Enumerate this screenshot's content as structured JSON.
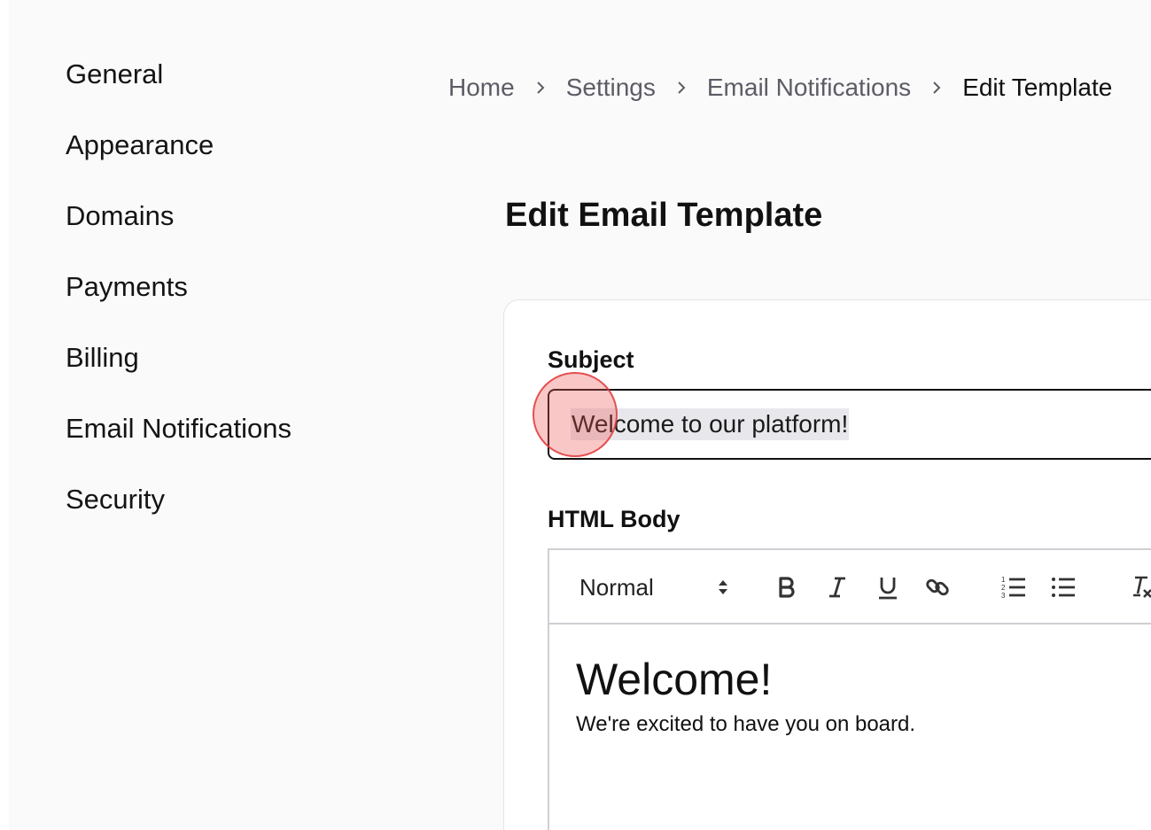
{
  "sidebar": {
    "items": [
      {
        "label": "General"
      },
      {
        "label": "Appearance"
      },
      {
        "label": "Domains"
      },
      {
        "label": "Payments"
      },
      {
        "label": "Billing"
      },
      {
        "label": "Email Notifications"
      },
      {
        "label": "Security"
      }
    ]
  },
  "breadcrumb": {
    "items": [
      {
        "label": "Home"
      },
      {
        "label": "Settings"
      },
      {
        "label": "Email Notifications"
      },
      {
        "label": "Edit Template"
      }
    ]
  },
  "page": {
    "title": "Edit Email Template"
  },
  "form": {
    "subject_label": "Subject",
    "subject_value": "Welcome to our platform!",
    "body_label": "HTML Body"
  },
  "editor": {
    "format_value": "Normal",
    "toolbar_icons": [
      "bold-icon",
      "italic-icon",
      "underline-icon",
      "link-icon",
      "ordered-list-icon",
      "bullet-list-icon",
      "clear-format-icon"
    ],
    "content": {
      "heading": "Welcome!",
      "paragraph": "We're excited to have you on board."
    }
  },
  "colors": {
    "text_primary": "#111111",
    "text_muted": "#5c5c66",
    "click_indicator": "#f05050"
  }
}
